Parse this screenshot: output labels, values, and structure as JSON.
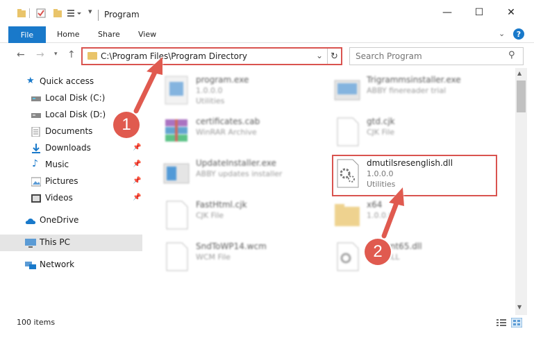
{
  "window": {
    "title": "Program",
    "minimize_icon": "minimize-icon",
    "maximize_icon": "maximize-icon",
    "close_icon": "close-icon"
  },
  "ribbon": {
    "file": "File",
    "tabs": [
      "Home",
      "Share",
      "View"
    ]
  },
  "nav": {
    "address": "C:\\Program Files\\Program Directory",
    "search_placeholder": "Search Program"
  },
  "sidebar": {
    "items": [
      {
        "label": "Quick access",
        "icon": "star-icon"
      },
      {
        "label": "Local Disk (C:)",
        "icon": "drive-icon"
      },
      {
        "label": "Local Disk (D:)",
        "icon": "drive-icon"
      },
      {
        "label": "Documents",
        "icon": "documents-icon"
      },
      {
        "label": "Downloads",
        "icon": "download-icon"
      },
      {
        "label": "Music",
        "icon": "music-icon"
      },
      {
        "label": "Pictures",
        "icon": "pictures-icon"
      },
      {
        "label": "Videos",
        "icon": "videos-icon"
      },
      {
        "label": "OneDrive",
        "icon": "cloud-icon"
      },
      {
        "label": "This PC",
        "icon": "computer-icon"
      },
      {
        "label": "Network",
        "icon": "network-icon"
      }
    ]
  },
  "files": [
    {
      "name": "program.exe",
      "line1": "1.0.0.0",
      "line2": "Utilities"
    },
    {
      "name": "Trigrammsinstaller.exe",
      "line1": "ABBY finereader trial",
      "line2": ""
    },
    {
      "name": "certificates.cab",
      "line1": "WinRAR Archive",
      "line2": ""
    },
    {
      "name": "gtd.cjk",
      "line1": "CJK File",
      "line2": ""
    },
    {
      "name": "UpdateInstaller.exe",
      "line1": "ABBY updates installer",
      "line2": ""
    },
    {
      "name": "dmutilsresenglish.dll",
      "line1": "1.0.0.0",
      "line2": "Utilities"
    },
    {
      "name": "FastHtml.cjk",
      "line1": "CJK File",
      "line2": ""
    },
    {
      "name": "x64",
      "line1": "1.0.0.0",
      "line2": ""
    },
    {
      "name": "SndToWP14.wcm",
      "line1": "WCM File",
      "line2": ""
    },
    {
      "name": "...Client65.dll",
      "line1": "...ce DLL",
      "line2": ""
    }
  ],
  "status": {
    "count": "100 items"
  },
  "annotations": {
    "badge1": "1",
    "badge2": "2"
  }
}
